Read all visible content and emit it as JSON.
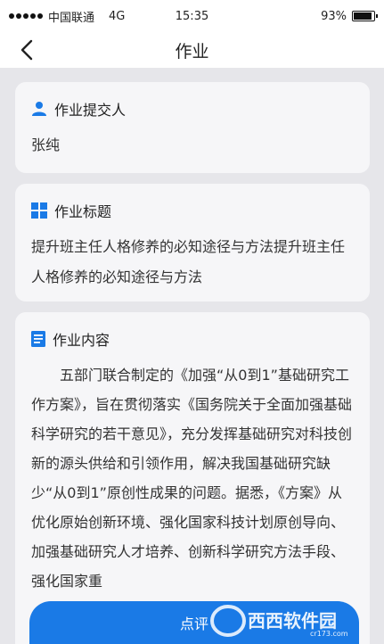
{
  "status_bar": {
    "carrier": "中国联通",
    "network": "4G",
    "time": "15:35",
    "battery": "93%",
    "battery_level": 0.93
  },
  "nav": {
    "title": "作业"
  },
  "submitter": {
    "label": "作业提交人",
    "value": "张纯"
  },
  "homework_title": {
    "label": "作业标题",
    "value": "提升班主任人格修养的必知途径与方法提升班主任人格修养的必知途径与方法"
  },
  "homework_content": {
    "label": "作业内容",
    "value": "五部门联合制定的《加强“从0到1”基础研究工作方案》，旨在贯彻落实《国务院关于全面加强基础科学研究的若干意见》，充分发挥基础研究对科技创新的源头供给和引领作用，解决我国基础研究缺少“从0到1”原创性成果的问题。据悉，《方案》从优化原始创新环境、强化国家科技计划原创导向、加强基础研究人才培养、创新科学研究方法手段、强化国家重"
  },
  "action": {
    "comment_label": "点评"
  },
  "watermark": {
    "text": "西西软件园",
    "subtext": "cr173.com"
  },
  "colors": {
    "accent": "#1a7ae6",
    "background": "#e6e6ea",
    "card": "#f6f6f8"
  }
}
